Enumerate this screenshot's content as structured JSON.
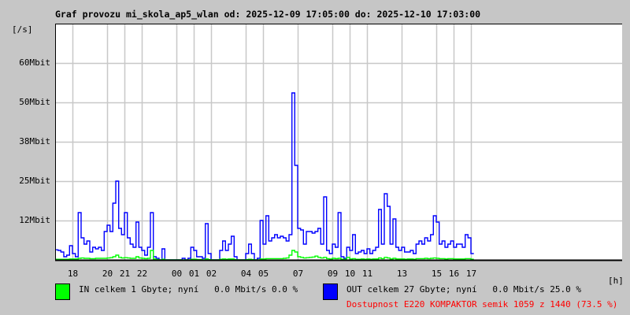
{
  "chart_data": {
    "type": "line",
    "title": "Graf provozu mi_skola_ap5_wlan od: 2025-12-09 17:05:00 do: 2025-12-10 17:03:00",
    "ylabel": "[/s]",
    "xlabel": "[h]",
    "ylim": [
      0,
      75
    ],
    "y_unit": "Mbit/s",
    "yticks": [
      {
        "value": 12.5,
        "label": "12Mbit"
      },
      {
        "value": 25,
        "label": "25Mbit"
      },
      {
        "value": 37.5,
        "label": "38Mbit"
      },
      {
        "value": 50,
        "label": "50Mbit"
      },
      {
        "value": 62.5,
        "label": "60Mbit"
      }
    ],
    "x_start_hour_offset": 0,
    "sample_interval_minutes": 10,
    "xticks": [
      {
        "hour": 1,
        "label": "18"
      },
      {
        "hour": 3,
        "label": "20"
      },
      {
        "hour": 4,
        "label": "21"
      },
      {
        "hour": 5,
        "label": "22"
      },
      {
        "hour": 7,
        "label": "00"
      },
      {
        "hour": 8,
        "label": "01"
      },
      {
        "hour": 9,
        "label": "02"
      },
      {
        "hour": 11,
        "label": "04"
      },
      {
        "hour": 12,
        "label": "05"
      },
      {
        "hour": 14,
        "label": "07"
      },
      {
        "hour": 16,
        "label": "09"
      },
      {
        "hour": 17,
        "label": "10"
      },
      {
        "hour": 18,
        "label": "11"
      },
      {
        "hour": 20,
        "label": "13"
      },
      {
        "hour": 22,
        "label": "15"
      },
      {
        "hour": 23,
        "label": "16"
      },
      {
        "hour": 24,
        "label": "17"
      }
    ],
    "grid": true,
    "series": [
      {
        "name": "OUT",
        "color": "#0000ff",
        "values": [
          3.2,
          3.0,
          2.5,
          1.0,
          1.5,
          4.5,
          2.0,
          1.0,
          15,
          7,
          5,
          6,
          2.5,
          4,
          3.5,
          4,
          3,
          9,
          11,
          9,
          18,
          25,
          10,
          8,
          15,
          7,
          5,
          4,
          12,
          4,
          3,
          1.5,
          4,
          15,
          1,
          0.5,
          0,
          3.5,
          0,
          0,
          0,
          0,
          0,
          0,
          0.5,
          0,
          0.5,
          4,
          3,
          1,
          1,
          0.5,
          11.5,
          2,
          0,
          0,
          0,
          3,
          6,
          3,
          5,
          7.5,
          1,
          0,
          0,
          0,
          2,
          5,
          2,
          0,
          0.5,
          12.5,
          5,
          14,
          6,
          7,
          8,
          7,
          7.5,
          7,
          6,
          8,
          53,
          30,
          10,
          9.5,
          5,
          9,
          9,
          8.5,
          9,
          10,
          5,
          20,
          3,
          2,
          5,
          4,
          15,
          1,
          0.5,
          4,
          3,
          8,
          2,
          2.5,
          3,
          2,
          3.5,
          2,
          3,
          4,
          16,
          5,
          21,
          17,
          5,
          13,
          4,
          3,
          4,
          2.5,
          2.5,
          3,
          2,
          5,
          6,
          5,
          7,
          6,
          8,
          14,
          12,
          5,
          6,
          4,
          5,
          6,
          4,
          5,
          5,
          4,
          8,
          7,
          2
        ]
      },
      {
        "name": "IN",
        "color": "#00ff00",
        "values": [
          0.2,
          0.2,
          0.2,
          0.2,
          0.2,
          0.3,
          0.3,
          0.3,
          0.5,
          0.6,
          0.5,
          0.5,
          0.4,
          0.4,
          0.5,
          0.5,
          0.5,
          0.5,
          0.6,
          0.7,
          1.0,
          1.5,
          0.8,
          0.6,
          0.7,
          0.6,
          0.5,
          0.5,
          1.0,
          0.6,
          0.5,
          0.4,
          0.5,
          3.0,
          0.3,
          0.1,
          0,
          0.2,
          0,
          0,
          0,
          0,
          0,
          0,
          0,
          0,
          0,
          0.2,
          0.2,
          0.1,
          0.1,
          0,
          0.3,
          0.1,
          0,
          0,
          0,
          0.2,
          0.3,
          0.2,
          0.3,
          0.3,
          0.1,
          0,
          0,
          0,
          0.1,
          0.2,
          0.1,
          0,
          0,
          0.3,
          0.3,
          0.4,
          0.4,
          0.4,
          0.4,
          0.4,
          0.4,
          0.5,
          0.6,
          1.5,
          3.0,
          2.5,
          1.0,
          0.8,
          0.6,
          0.7,
          0.8,
          0.9,
          1.2,
          0.8,
          0.6,
          0.8,
          0.4,
          0.3,
          0.5,
          0.4,
          0.5,
          0.2,
          0.2,
          0.8,
          0.3,
          0.4,
          0.2,
          0.2,
          0.3,
          0.2,
          0.3,
          0.2,
          0.3,
          0.3,
          0.6,
          0.4,
          0.8,
          0.6,
          0.3,
          0.5,
          0.3,
          0.3,
          0.3,
          0.2,
          0.3,
          0.3,
          0.2,
          0.4,
          0.4,
          0.4,
          0.5,
          0.4,
          0.5,
          0.6,
          0.5,
          0.4,
          0.4,
          0.3,
          0.4,
          0.4,
          0.3,
          0.3,
          0.3,
          0.3,
          0.4,
          0.4,
          0.2
        ]
      }
    ]
  },
  "legend": {
    "in_color": "#00ff00",
    "out_color": "#0000ff",
    "in_text": "IN celkem 1 Gbyte; nyní   0.0 Mbit/s 0.0 %",
    "out_text": "OUT celkem 27 Gbyte; nyní   0.0 Mbit/s 25.0 %",
    "availability_text": "Dostupnost E220 KOMPAKTOR semik 1059 z 1440 (73.5 %)",
    "availability_color": "#ff0000"
  }
}
